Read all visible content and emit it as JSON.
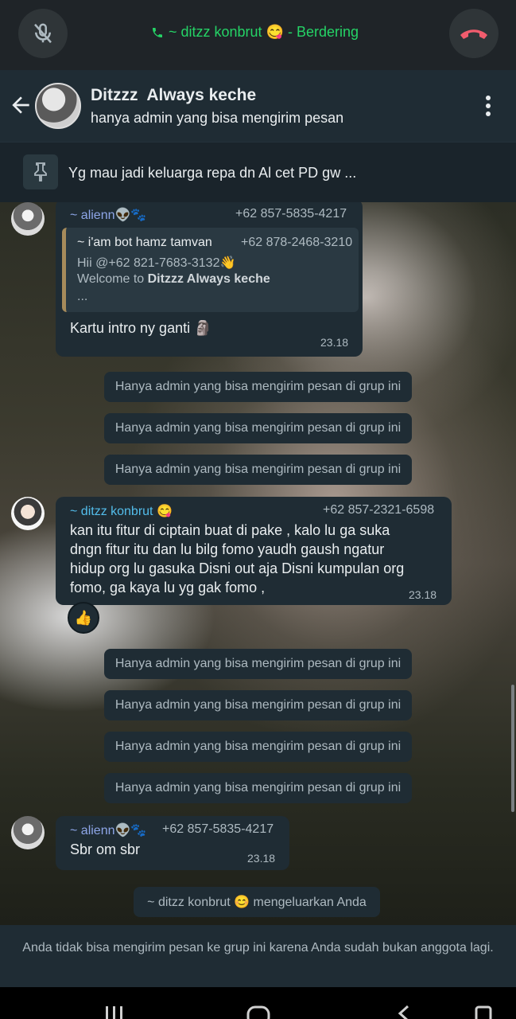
{
  "call_bar": {
    "title": "~ ditzz konbrut 😋 - Berdering"
  },
  "header": {
    "group_name": "Ditzzz  Always keche",
    "subtitle": "hanya admin yang bisa mengirim pesan"
  },
  "pinned": {
    "text": "Yg mau jadi keluarga repa dn Al cet PD gw ..."
  },
  "messages": [
    {
      "sender": "~ alienn👽🐾",
      "phone": "+62 857-5835-4217",
      "quote": {
        "sender": "~ i'am bot hamz tamvan",
        "phone": "+62 878-2468-3210",
        "line1": "Hii @+62 821-7683-3132👋",
        "line2_prefix": "Welcome to ",
        "line2_bold": "Ditzzz  Always keche",
        "line3": "..."
      },
      "text": "Kartu intro ny ganti 🗿",
      "time": "23.18"
    },
    {
      "sender": "~ ditzz konbrut 😋",
      "phone": "+62 857-2321-6598",
      "lines": [
        "kan itu fitur di ciptain buat di pake , kalo lu ga suka",
        "dngn fitur itu dan lu bilg fomo yaudh gaush ngatur",
        "hidup org lu gasuka Disni out aja  Disni kumpulan org",
        "fomo, ga kaya lu yg gak fomo ,"
      ],
      "time": "23.18",
      "reaction": "👍"
    },
    {
      "sender": "~ alienn👽🐾",
      "phone": "+62 857-5835-4217",
      "text": "Sbr om sbr",
      "time": "23.18"
    }
  ],
  "system_messages": [
    "Hanya admin yang bisa mengirim pesan di grup ini",
    "Hanya admin yang bisa mengirim pesan di grup ini",
    "Hanya admin yang bisa mengirim pesan di grup ini",
    "Hanya admin yang bisa mengirim pesan di grup ini",
    "Hanya admin yang bisa mengirim pesan di grup ini",
    "Hanya admin yang bisa mengirim pesan di grup ini",
    "Hanya admin yang bisa mengirim pesan di grup ini"
  ],
  "removed_notice": "~ ditzz konbrut 😊 mengeluarkan Anda",
  "footer": {
    "text": "Anda tidak bisa mengirim pesan ke grup ini karena Anda sudah bukan anggota lagi."
  },
  "colors": {
    "call_green": "#25d366",
    "end_call_red": "#f15c6d",
    "sender_blue": "#53bdeb",
    "bubble_bg": "#1f2c34"
  },
  "icons": [
    "mic-off-icon",
    "phone-icon",
    "end-call-icon",
    "back-arrow-icon",
    "more-vert-icon",
    "pin-icon",
    "recents-icon",
    "home-icon",
    "back-nav-icon"
  ]
}
